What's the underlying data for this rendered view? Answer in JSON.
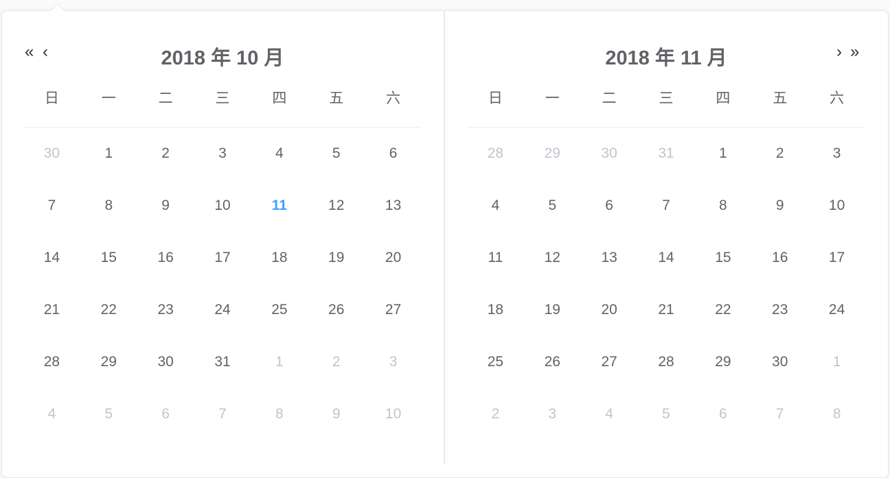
{
  "colors": {
    "text": "#606266",
    "muted": "#c0c4cc",
    "today": "#409eff",
    "border": "#e4e7ed"
  },
  "weekdays": [
    "日",
    "一",
    "二",
    "三",
    "四",
    "五",
    "六"
  ],
  "nav": {
    "prev_year": "«",
    "prev_month": "‹",
    "next_month": "›",
    "next_year": "»"
  },
  "left": {
    "title": "2018 年 10 月",
    "weeks": [
      [
        [
          "30",
          "muted"
        ],
        [
          "1",
          ""
        ],
        [
          "2",
          ""
        ],
        [
          "3",
          ""
        ],
        [
          "4",
          ""
        ],
        [
          "5",
          ""
        ],
        [
          "6",
          ""
        ]
      ],
      [
        [
          "7",
          ""
        ],
        [
          "8",
          ""
        ],
        [
          "9",
          ""
        ],
        [
          "10",
          ""
        ],
        [
          "11",
          "today"
        ],
        [
          "12",
          ""
        ],
        [
          "13",
          ""
        ]
      ],
      [
        [
          "14",
          ""
        ],
        [
          "15",
          ""
        ],
        [
          "16",
          ""
        ],
        [
          "17",
          ""
        ],
        [
          "18",
          ""
        ],
        [
          "19",
          ""
        ],
        [
          "20",
          ""
        ]
      ],
      [
        [
          "21",
          ""
        ],
        [
          "22",
          ""
        ],
        [
          "23",
          ""
        ],
        [
          "24",
          ""
        ],
        [
          "25",
          ""
        ],
        [
          "26",
          ""
        ],
        [
          "27",
          ""
        ]
      ],
      [
        [
          "28",
          ""
        ],
        [
          "29",
          ""
        ],
        [
          "30",
          ""
        ],
        [
          "31",
          ""
        ],
        [
          "1",
          "muted"
        ],
        [
          "2",
          "muted"
        ],
        [
          "3",
          "muted"
        ]
      ],
      [
        [
          "4",
          "muted"
        ],
        [
          "5",
          "muted"
        ],
        [
          "6",
          "muted"
        ],
        [
          "7",
          "muted"
        ],
        [
          "8",
          "muted"
        ],
        [
          "9",
          "muted"
        ],
        [
          "10",
          "muted"
        ]
      ]
    ]
  },
  "right": {
    "title": "2018 年 11 月",
    "weeks": [
      [
        [
          "28",
          "muted"
        ],
        [
          "29",
          "muted"
        ],
        [
          "30",
          "muted"
        ],
        [
          "31",
          "muted"
        ],
        [
          "1",
          ""
        ],
        [
          "2",
          ""
        ],
        [
          "3",
          ""
        ]
      ],
      [
        [
          "4",
          ""
        ],
        [
          "5",
          ""
        ],
        [
          "6",
          ""
        ],
        [
          "7",
          ""
        ],
        [
          "8",
          ""
        ],
        [
          "9",
          ""
        ],
        [
          "10",
          ""
        ]
      ],
      [
        [
          "11",
          ""
        ],
        [
          "12",
          ""
        ],
        [
          "13",
          ""
        ],
        [
          "14",
          ""
        ],
        [
          "15",
          ""
        ],
        [
          "16",
          ""
        ],
        [
          "17",
          ""
        ]
      ],
      [
        [
          "18",
          ""
        ],
        [
          "19",
          ""
        ],
        [
          "20",
          ""
        ],
        [
          "21",
          ""
        ],
        [
          "22",
          ""
        ],
        [
          "23",
          ""
        ],
        [
          "24",
          ""
        ]
      ],
      [
        [
          "25",
          ""
        ],
        [
          "26",
          ""
        ],
        [
          "27",
          ""
        ],
        [
          "28",
          ""
        ],
        [
          "29",
          ""
        ],
        [
          "30",
          ""
        ],
        [
          "1",
          "muted"
        ]
      ],
      [
        [
          "2",
          "muted"
        ],
        [
          "3",
          "muted"
        ],
        [
          "4",
          "muted"
        ],
        [
          "5",
          "muted"
        ],
        [
          "6",
          "muted"
        ],
        [
          "7",
          "muted"
        ],
        [
          "8",
          "muted"
        ]
      ]
    ]
  }
}
